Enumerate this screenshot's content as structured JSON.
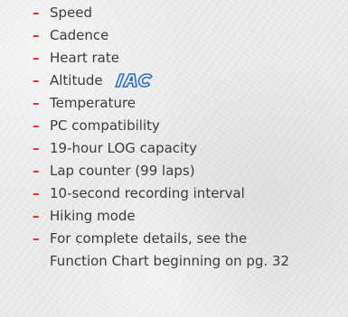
{
  "features": [
    {
      "label": "Speed"
    },
    {
      "label": "Cadence"
    },
    {
      "label": "Heart rate"
    },
    {
      "label": "Altitude",
      "logo": "iac-logo"
    },
    {
      "label": "Temperature"
    },
    {
      "label": "PC compatibility"
    },
    {
      "label": "19-hour LOG capacity"
    },
    {
      "label": "Lap counter (99 laps)"
    },
    {
      "label": "10-second recording interval"
    },
    {
      "label": "Hiking mode"
    }
  ],
  "details": {
    "line1": "For complete details, see the",
    "line2": "Function Chart beginning on pg. 32"
  },
  "bullet_symbol": "–",
  "colors": {
    "bullet": "#e6262d",
    "text": "#3c3c3c",
    "logo": "#2f6fc6",
    "background": "#ececec"
  }
}
